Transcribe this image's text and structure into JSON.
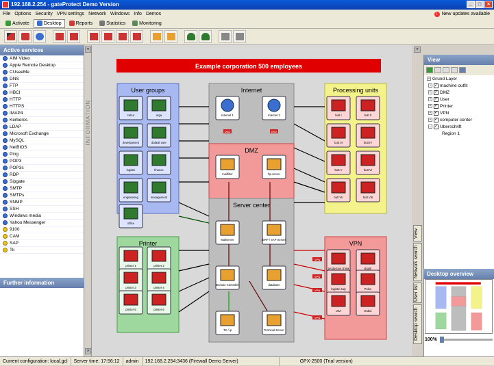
{
  "window": {
    "title": "192.168.2.254 - gateProtect Demo Version"
  },
  "menu": [
    "File",
    "Options",
    "Security",
    "VPN settings",
    "Network",
    "Windows",
    "Info",
    "Demos"
  ],
  "updates_text": "New updates available",
  "tabs": [
    "Activate",
    "Desktop",
    "Reports",
    "Statistics",
    "Monitoring"
  ],
  "left_panel": {
    "title": "Active services",
    "services": [
      "AIM Video",
      "Apple Remote Desktop",
      "CUseeMe",
      "DNS",
      "FTP",
      "HBCI",
      "HTTP",
      "HTTPS",
      "IMAP4",
      "Kerberos",
      "LDAP",
      "Microsoft Exchange",
      "MySQL",
      "NetBIOS",
      "Ping",
      "POP3",
      "POP3s",
      "RDP",
      "Sipgate",
      "SMTP",
      "SMTPs",
      "SNMP",
      "SSH",
      "Windows media",
      "Yahoo Messenger"
    ],
    "yellow_services": [
      "9100",
      "CAM",
      "SAP",
      "Tk"
    ],
    "further_title": "Further information"
  },
  "strip_label": "INFORMATION",
  "diagram": {
    "banner": "Example corporation 500 employees",
    "zones": {
      "user_groups": {
        "title": "User groups",
        "nodes": [
          "zuhur",
          "orga",
          "development",
          "dafault user",
          "logistic",
          "finance",
          "engineering",
          "management",
          "office"
        ]
      },
      "internet": {
        "title": "Internet",
        "nodes": [
          "Internet 1",
          "Internet 2"
        ]
      },
      "dmz": {
        "title": "DMZ",
        "nodes": [
          "mailfilter",
          "ftp-server"
        ],
        "tags": [
          "DMZ",
          "DMZ"
        ]
      },
      "processing": {
        "title": "Processing units",
        "nodes": [
          "butt I",
          "butt II",
          "butt III",
          "butt IV",
          "butt V",
          "butt VI",
          "butt VII",
          "butt VIII"
        ]
      },
      "server": {
        "title": "Server center",
        "nodes": [
          "Mailserver",
          "ERP / SAP Server",
          "Domain Controller",
          "database",
          "TK / ip",
          "Terminal-Server"
        ]
      },
      "printer": {
        "title": "Printer",
        "nodes": [
          "printer 1",
          "printer 2",
          "printer 3",
          "printer 4",
          "printer 5",
          "printer 6"
        ]
      },
      "vpn": {
        "title": "VPN",
        "nodes": [
          "production china",
          "Brazil",
          "logistic italy",
          "Polen",
          "USA",
          "Dubai"
        ],
        "tag": "VPN"
      }
    }
  },
  "right_panel": {
    "view_title": "View",
    "tree": [
      {
        "label": "Grund Layer",
        "checkbox": false
      },
      {
        "label": "machine outfit",
        "checkbox": true
      },
      {
        "label": "DMZ",
        "checkbox": true
      },
      {
        "label": "User",
        "checkbox": true
      },
      {
        "label": "Printer",
        "checkbox": true
      },
      {
        "label": "VPN",
        "checkbox": true
      },
      {
        "label": "computer center",
        "checkbox": true
      },
      {
        "label": "Uberschrift",
        "checkbox": true
      },
      {
        "label": "Region 1",
        "checkbox": false
      }
    ],
    "vtabs": [
      "View",
      "Network search",
      "User list",
      "Desktop search"
    ],
    "overview_title": "Desktop overview",
    "zoom": "100%"
  },
  "status": {
    "config": "Current configuration: local.gcl",
    "time": "Server time: 17:56:12",
    "user": "admin",
    "server": "192.168.2.254:3436 (Firewall Demo Server)",
    "version": "GPX-2500 (Trial version)"
  },
  "colors": {
    "user_zone": "#a8b8f0",
    "internet_zone": "#bdbdbd",
    "dmz_zone": "#f29a9a",
    "processing_zone": "#f4f28a",
    "server_zone": "#bdbdbd",
    "printer_zone": "#9fd89f",
    "vpn_zone": "#f29a9a",
    "banner": "#e00000"
  }
}
